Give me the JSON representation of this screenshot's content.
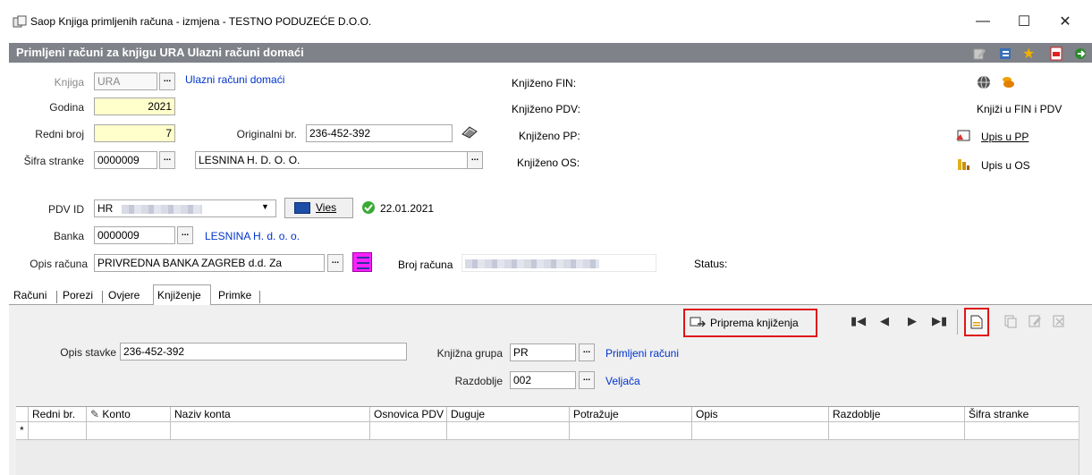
{
  "window": {
    "title": "Saop Knjiga primljenih računa - izmjena  - TESTNO PODUZEĆE D.O.O."
  },
  "header": {
    "title": "Primljeni računi za knjigu URA Ulazni računi domaći"
  },
  "form": {
    "knjiga_label": "Knjiga",
    "knjiga_value": "URA",
    "knjiga_link": "Ulazni računi domaći",
    "godina_label": "Godina",
    "godina_value": "2021",
    "redni_label": "Redni broj",
    "redni_value": "7",
    "originalni_label": "Originalni br.",
    "originalni_value": "236-452-392",
    "sifra_label": "Šifra stranke",
    "sifra_value": "0000009",
    "stranka_value": "LESNINA H. D. O. O.",
    "pdv_label": "PDV ID",
    "pdv_value": "HR",
    "vies_label": "Vies",
    "vies_date": "22.01.2021",
    "banka_label": "Banka",
    "banka_value": "0000009",
    "banka_link": "LESNINA H. d. o. o.",
    "opis_label": "Opis računa",
    "opis_value": "PRIVREDNA BANKA ZAGREB d.d. Za",
    "broj_label": "Broj računa",
    "status_label": "Status:"
  },
  "posting": {
    "fin_label": "Knjiženo FIN:",
    "pdv_label": "Knjiženo PDV:",
    "pp_label": "Knjiženo PP:",
    "os_label": "Knjiženo OS:"
  },
  "actions": {
    "knjizi_label": "Knjiži u FIN i PDV",
    "upis_pp_label": "Upis u PP",
    "upis_os_label": "Upis u OS"
  },
  "tabs": [
    {
      "label": "Računi"
    },
    {
      "label": "Porezi"
    },
    {
      "label": "Ovjere"
    },
    {
      "label": "Knjiženje",
      "active": true
    },
    {
      "label": "Primke"
    }
  ],
  "knjizenje": {
    "priprema_label": "Priprema knjiženja",
    "opis_stavke_label": "Opis stavke",
    "opis_stavke_value": "236-452-392",
    "grupa_label": "Knjižna grupa",
    "grupa_value": "PR",
    "grupa_link": "Primljeni računi",
    "razdoblje_label": "Razdoblje",
    "razdoblje_value": "002",
    "razdoblje_link": "Veljača"
  },
  "grid": {
    "columns": [
      "Redni br.",
      "Konto",
      "Naziv konta",
      "Osnovica PDV",
      "Duguje",
      "Potražuje",
      "Opis",
      "Razdoblje",
      "Šifra stranke"
    ],
    "new_row_marker": "*"
  },
  "colors": {
    "header_bg": "#7f8288",
    "required_bg": "#ffffcc",
    "link": "#0033cc",
    "highlight": "#e01515"
  }
}
